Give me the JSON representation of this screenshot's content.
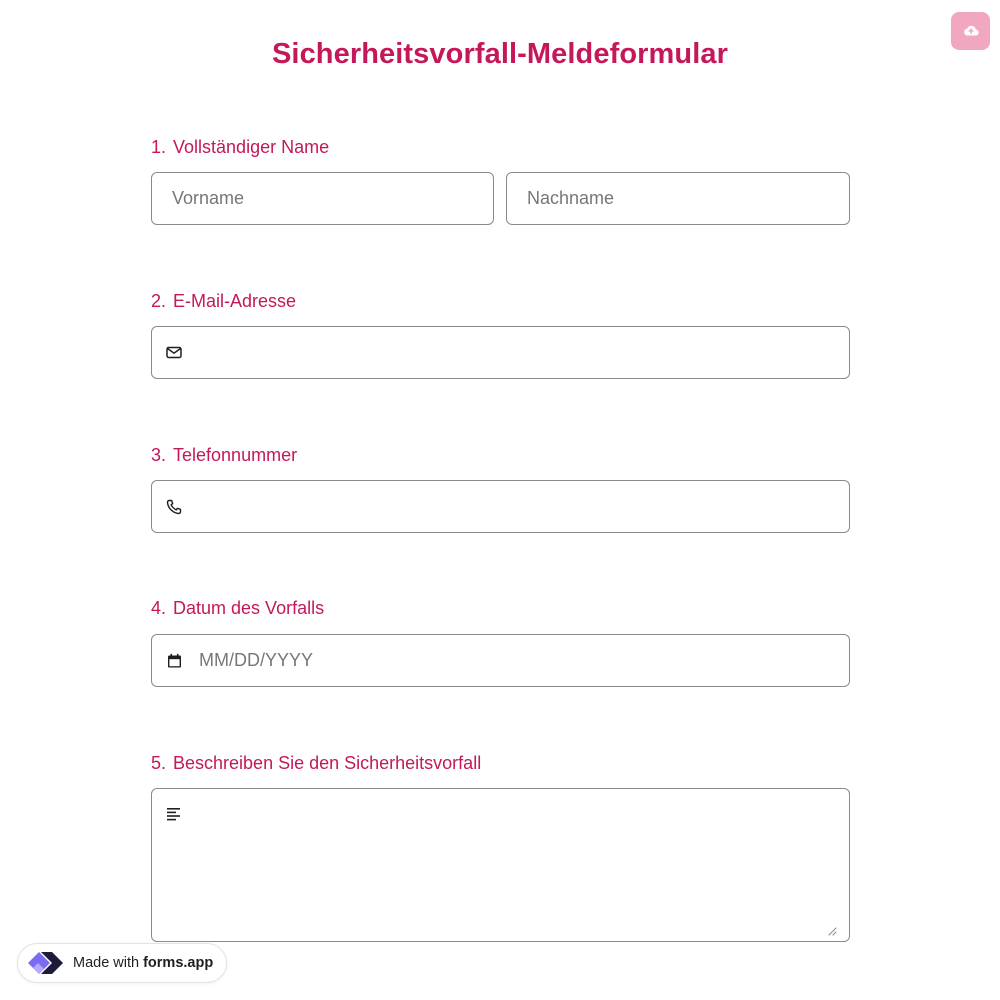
{
  "header": {
    "upload_icon": "cloud-upload-icon",
    "title": "Sicherheitsvorfall-Meldeformular"
  },
  "questions": [
    {
      "number": "1.",
      "label": "Vollständiger Name",
      "first_name_placeholder": "Vorname",
      "last_name_placeholder": "Nachname"
    },
    {
      "number": "2.",
      "label": "E-Mail-Adresse",
      "icon": "envelope-icon",
      "value": ""
    },
    {
      "number": "3.",
      "label": "Telefonnummer",
      "icon": "phone-icon",
      "value": ""
    },
    {
      "number": "4.",
      "label": "Datum des Vorfalls",
      "icon": "calendar-icon",
      "placeholder": "MM/DD/YYYY"
    },
    {
      "number": "5.",
      "label": "Beschreiben Sie den Sicherheitsvorfall",
      "icon": "text-align-left-icon",
      "value": ""
    }
  ],
  "badge": {
    "made_with": "Made with",
    "brand": "forms.app",
    "logo": "forms-app-logo"
  },
  "colors": {
    "accent": "#c4185a",
    "upload_button": "#f0a7bf",
    "border": "#8a8a8a"
  }
}
